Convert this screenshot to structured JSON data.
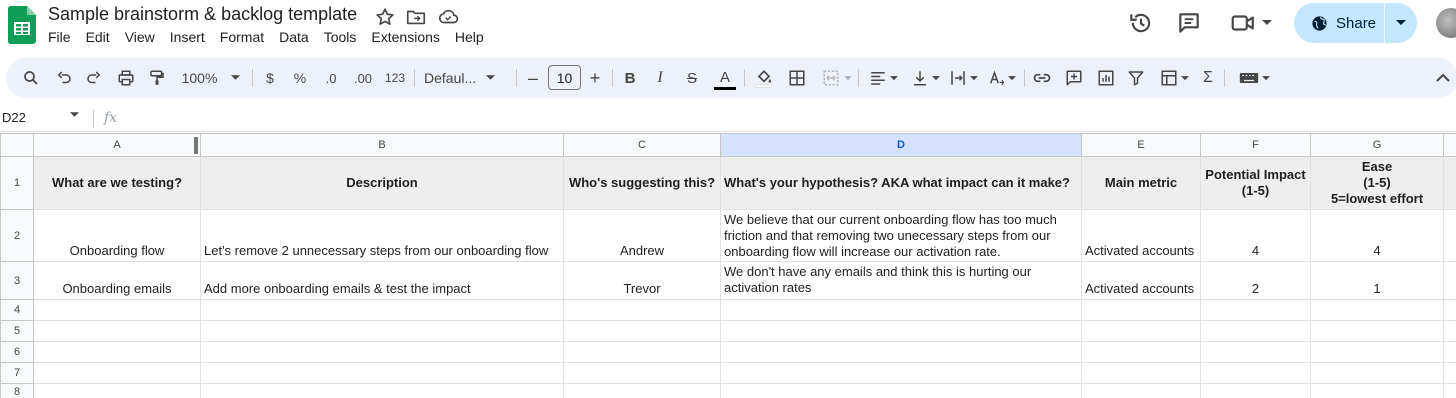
{
  "document": {
    "title": "Sample brainstorm & backlog template"
  },
  "menu": [
    "File",
    "Edit",
    "View",
    "Insert",
    "Format",
    "Data",
    "Tools",
    "Extensions",
    "Help"
  ],
  "share": {
    "label": "Share"
  },
  "toolbar": {
    "zoom": "100%",
    "currency": "$",
    "percent": "%",
    "decrease_decimal": ".0",
    "increase_decimal": ".00",
    "number_format": "123",
    "font": "Defaul...",
    "font_size": "10",
    "decrease_font": "–",
    "increase_font": "+",
    "bold": "B",
    "italic": "I",
    "strike": "S",
    "text_color": "A",
    "functions": "Σ"
  },
  "formula_bar": {
    "name_box": "D22",
    "fx": "fx"
  },
  "grid": {
    "columns": [
      "A",
      "B",
      "C",
      "D",
      "E",
      "F",
      "G"
    ],
    "selected_column": "D",
    "row_numbers": [
      "1",
      "2",
      "3",
      "4",
      "5",
      "6",
      "7",
      "8"
    ],
    "header_row": [
      "What are we testing?",
      "Description",
      "Who's suggesting this?",
      "What's your hypothesis? AKA what impact can it make?",
      "Main metric",
      "Potential Impact\n(1-5)",
      "Ease\n(1-5)\n5=lowest effort"
    ],
    "rows": [
      [
        "Onboarding flow",
        "Let's remove 2 unnecessary steps from our onboarding flow",
        "Andrew",
        "We believe that our current onboarding flow has too much friction and that removing two unecessary steps from our onboarding flow will increase our activation rate.",
        "Activated accounts",
        "4",
        "4"
      ],
      [
        "Onboarding emails",
        "Add more onboarding emails & test the impact",
        "Trevor",
        "We don't have any emails and think this is hurting our activation rates",
        "Activated accounts",
        "2",
        "1"
      ]
    ]
  },
  "colors": {
    "accent": "#0b57d0",
    "share_bg": "#c2e7ff",
    "toolbar_bg": "#edf2fa",
    "selected_col_bg": "#d3e3fd",
    "sheets_green": "#0f9d58"
  }
}
